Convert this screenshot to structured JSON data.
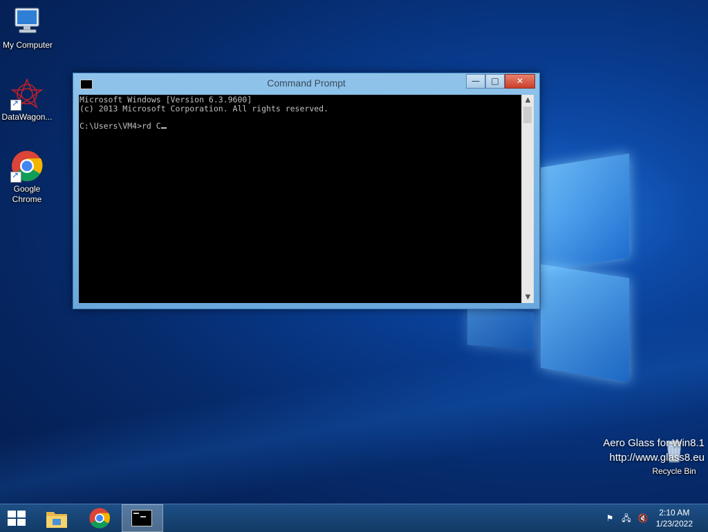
{
  "desktop": {
    "icons": [
      {
        "label": "My Computer",
        "icon": "computer-icon"
      },
      {
        "label": "DataWagon...",
        "icon": "datawagon-icon"
      },
      {
        "label": "Google Chrome",
        "icon": "chrome-icon"
      },
      {
        "label": "Recycle Bin",
        "icon": "recycle-bin-icon"
      }
    ],
    "watermark": {
      "line1": "Aero Glass for Win8.1",
      "line2": "http://www.glass8.eu"
    }
  },
  "cmd_window": {
    "title": "Command Prompt",
    "lines": [
      "Microsoft Windows [Version 6.3.9600]",
      "(c) 2013 Microsoft Corporation. All rights reserved.",
      "",
      "C:\\Users\\VM4>rd C"
    ],
    "controls": {
      "minimize": "—",
      "maximize": "□",
      "close": "✕"
    }
  },
  "taskbar": {
    "items": [
      "start-icon",
      "file-explorer-icon",
      "chrome-icon",
      "command-prompt-icon"
    ],
    "clock": {
      "time": "2:10 AM",
      "date": "1/23/2022"
    }
  },
  "colors": {
    "accent": "#1d4f86",
    "console_bg": "#000000",
    "console_fg": "#c0c0c0"
  }
}
